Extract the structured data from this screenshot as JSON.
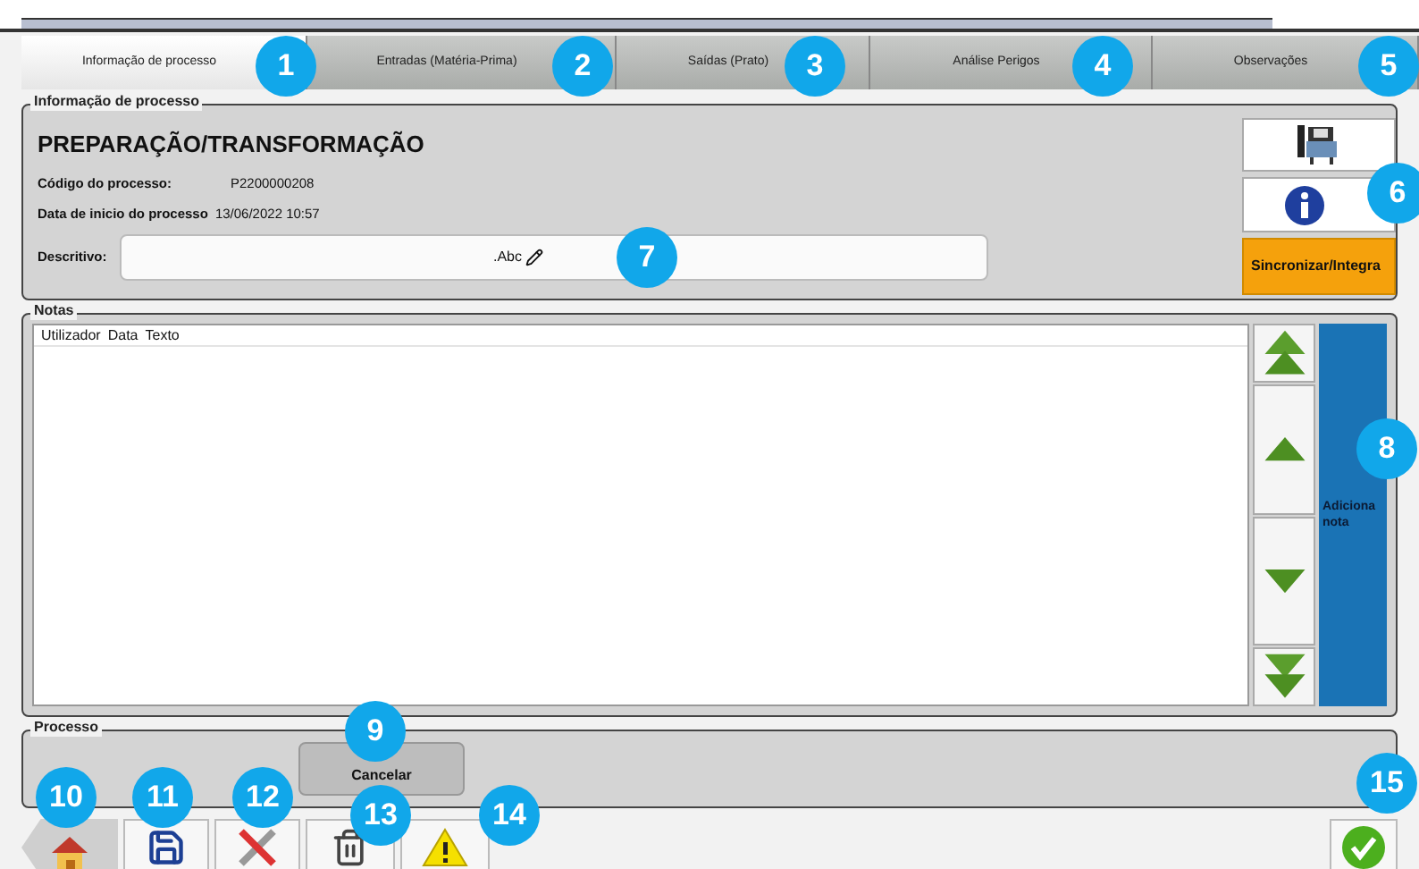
{
  "tabs": [
    {
      "label": "Informação de processo",
      "selected": true
    },
    {
      "label": "Entradas (Matéria-Prima)",
      "selected": false
    },
    {
      "label": "Saídas (Prato)",
      "selected": false
    },
    {
      "label": "Análise Perigos",
      "selected": false
    },
    {
      "label": "Observações",
      "selected": false
    }
  ],
  "process_info": {
    "group_title": "Informação de processo",
    "title": "PREPARAÇÃO/TRANSFORMAÇÃO",
    "fields": [
      {
        "label": "Código do processo:",
        "value": "P2200000208"
      },
      {
        "label": "Data de inicio do processo",
        "value": "13/06/2022 10:57"
      }
    ],
    "description": {
      "label": "Descritivo:",
      "hint": ".Abc"
    },
    "sync_button": "Sincronizar/Integra"
  },
  "notes": {
    "group_title": "Notas",
    "columns": [
      "Utilizador",
      "Data",
      "Texto"
    ],
    "add_button": "Adiciona nota"
  },
  "process": {
    "group_title": "Processo",
    "cancel_button": "Cancelar"
  },
  "callouts": [
    "1",
    "2",
    "3",
    "4",
    "5",
    "6",
    "7",
    "8",
    "9",
    "10",
    "11",
    "12",
    "13",
    "14",
    "15"
  ]
}
